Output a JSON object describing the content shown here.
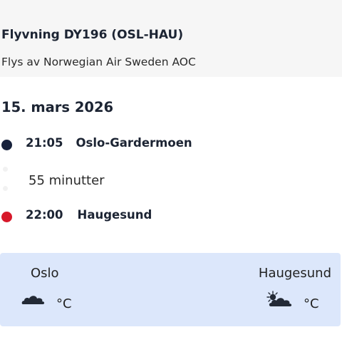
{
  "flight": {
    "title": "Flyvning DY196 (OSL-HAU)",
    "operator": "Flys av Norwegian Air Sweden AOC"
  },
  "date": "15. mars 2026",
  "departure": {
    "time": "21:05",
    "place": "Oslo-Gardermoen"
  },
  "duration": "55 minutter",
  "arrival": {
    "time": "22:00",
    "place": "Haugesund"
  },
  "weather": {
    "origin": {
      "city": "Oslo",
      "icon": "cloud-icon",
      "unit": "°C"
    },
    "destination": {
      "city": "Haugesund",
      "icon": "sun-behind-cloud-icon",
      "unit": "°C"
    }
  },
  "colors": {
    "departure_dot": "#17213b",
    "arrival_dot": "#d7182a",
    "weather_panel": "#dce7fb"
  }
}
